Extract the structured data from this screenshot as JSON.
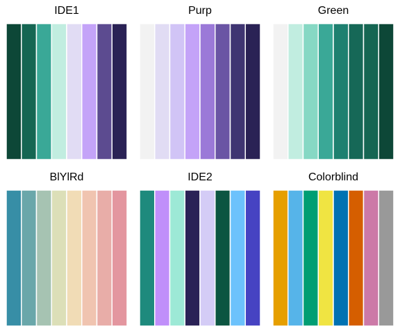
{
  "chart_data": [
    {
      "type": "bar",
      "title": "IDE1",
      "values": [
        1,
        1,
        1,
        1,
        1,
        1,
        1,
        1
      ],
      "colors": [
        "#0d4737",
        "#156653",
        "#3aa897",
        "#c1ede0",
        "#e1dcf4",
        "#c4a3f8",
        "#5c4b90",
        "#2a2255"
      ]
    },
    {
      "type": "bar",
      "title": "Purp",
      "values": [
        1,
        1,
        1,
        1,
        1,
        1,
        1,
        1
      ],
      "colors": [
        "#f2f2f2",
        "#e1dcf4",
        "#d1c4f6",
        "#c4a3f8",
        "#9b79d8",
        "#6a55a4",
        "#3f3572",
        "#2a2255"
      ]
    },
    {
      "type": "bar",
      "title": "Green",
      "values": [
        1,
        1,
        1,
        1,
        1,
        1,
        1,
        1
      ],
      "colors": [
        "#f2f2f2",
        "#c1ede0",
        "#86d8c4",
        "#3aa897",
        "#1d8070",
        "#166857",
        "#156653",
        "#0d4737"
      ]
    },
    {
      "type": "bar",
      "title": "BlYlRd",
      "values": [
        1,
        1,
        1,
        1,
        1,
        1,
        1,
        1
      ],
      "colors": [
        "#378ea6",
        "#6aa7aa",
        "#a6c3b2",
        "#dcdfb8",
        "#f1dcb6",
        "#f0c4b0",
        "#e8ada8",
        "#e3969f"
      ]
    },
    {
      "type": "bar",
      "title": "IDE2",
      "values": [
        1,
        1,
        1,
        1,
        1,
        1,
        1,
        1
      ],
      "colors": [
        "#1e8a7d",
        "#c08ffa",
        "#9de9d6",
        "#2a2256",
        "#d4ccf6",
        "#0c5541",
        "#6cc2fc",
        "#4643c2"
      ]
    },
    {
      "type": "bar",
      "title": "Colorblind",
      "values": [
        1,
        1,
        1,
        1,
        1,
        1,
        1,
        1
      ],
      "colors": [
        "#e69f00",
        "#56b4e9",
        "#009e73",
        "#f0e442",
        "#0072b2",
        "#d55e00",
        "#cc79a7",
        "#999999"
      ]
    }
  ]
}
